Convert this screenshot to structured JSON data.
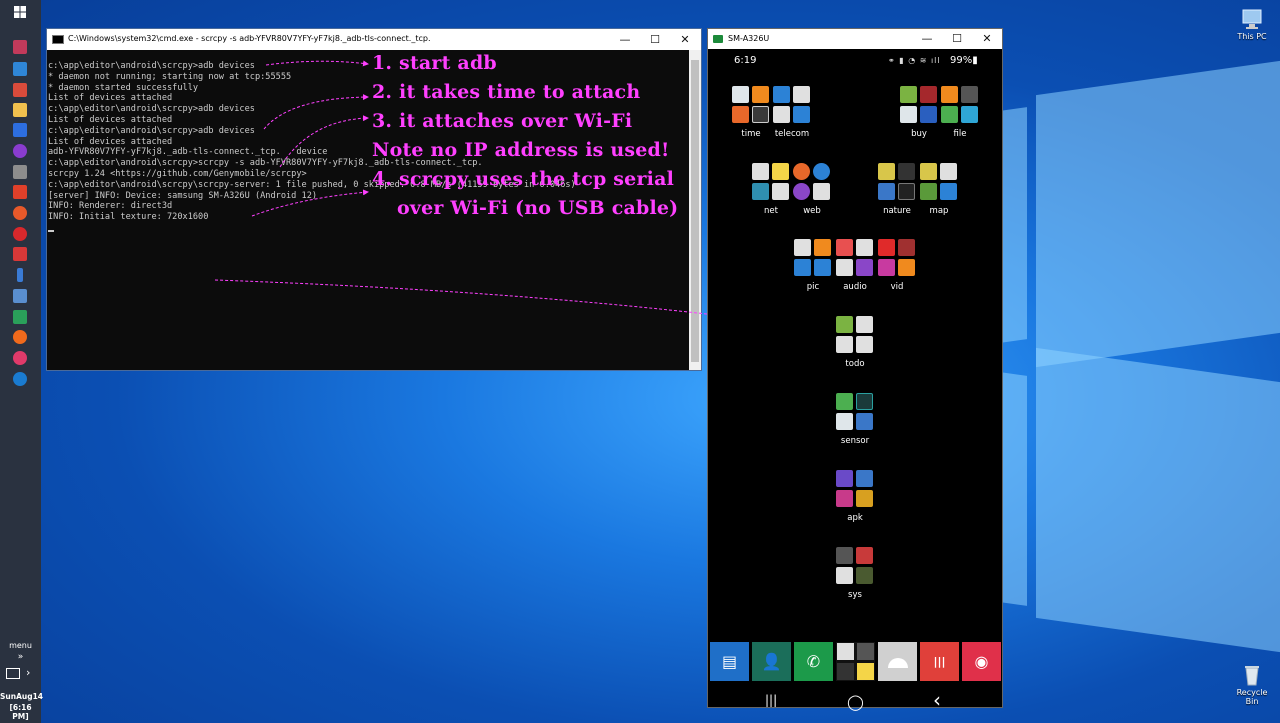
{
  "taskbar": {
    "menu_label": "menu",
    "menu_chevron": "»",
    "tray_arrow": "›",
    "date": "SunAug14",
    "time": "[6:16 PM]"
  },
  "desktop": {
    "this_pc_label": "This PC",
    "recycle_bin_label": "Recycle Bin"
  },
  "cmd": {
    "title": "C:\\Windows\\system32\\cmd.exe - scrcpy  -s adb-YFVR80V7YFY-yF7kj8._adb-tls-connect._tcp.",
    "minimize": "—",
    "maximize": "☐",
    "close": "✕",
    "lines": [
      "c:\\app\\editor\\android\\scrcpy>adb devices",
      "* daemon not running; starting now at tcp:55555",
      "* daemon started successfully",
      "List of devices attached",
      "",
      "",
      "c:\\app\\editor\\android\\scrcpy>adb devices",
      "List of devices attached",
      "",
      "",
      "c:\\app\\editor\\android\\scrcpy>adb devices",
      "List of devices attached",
      "adb-YFVR80V7YFY-yF7kj8._adb-tls-connect._tcp.   device",
      "",
      "c:\\app\\editor\\android\\scrcpy>scrcpy -s adb-YFVR80V7YFY-yF7kj8._adb-tls-connect._tcp.",
      "scrcpy 1.24 <https://github.com/Genymobile/scrcpy>",
      "c:\\app\\editor\\android\\scrcpy\\scrcpy-server: 1 file pushed, 0 skipped. 0.8 MB/s (41159 bytes in 0.046s)",
      "[server] INFO: Device: samsung SM-A326U (Android 12)",
      "INFO: Renderer: direct3d",
      "INFO: Initial texture: 720x1600"
    ]
  },
  "annotations": {
    "a1": "1. start adb",
    "a2": "2. it takes time to attach",
    "a3": "3. it attaches over Wi-Fi",
    "a4": "Note no IP address is used!",
    "a5": "4. scrcpy uses the tcp serial",
    "a6": "over Wi-Fi (no USB cable)",
    "color": "#ff40ff"
  },
  "phone": {
    "title": "SM-A326U",
    "minimize": "—",
    "maximize": "☐",
    "close": "✕",
    "status_time": "6:19",
    "status_icons": "⚭ ▮ ◔ ≋ ıll",
    "battery": "99%▮",
    "folders": {
      "time": "time",
      "telecom": "telecom",
      "buy": "buy",
      "file": "file",
      "net": "net",
      "web": "web",
      "nature": "nature",
      "map": "map",
      "pic": "pic",
      "audio": "audio",
      "vid": "vid",
      "todo": "todo",
      "sensor": "sensor",
      "apk": "apk",
      "sys": "sys"
    },
    "dock": {
      "messages_icon": "▤",
      "contacts_icon": "👤",
      "phone_icon": "✆",
      "voice_icon": "|||",
      "camera_icon": "◉"
    },
    "nav": {
      "recents": "|||",
      "home": "◯",
      "back": "‹"
    }
  }
}
